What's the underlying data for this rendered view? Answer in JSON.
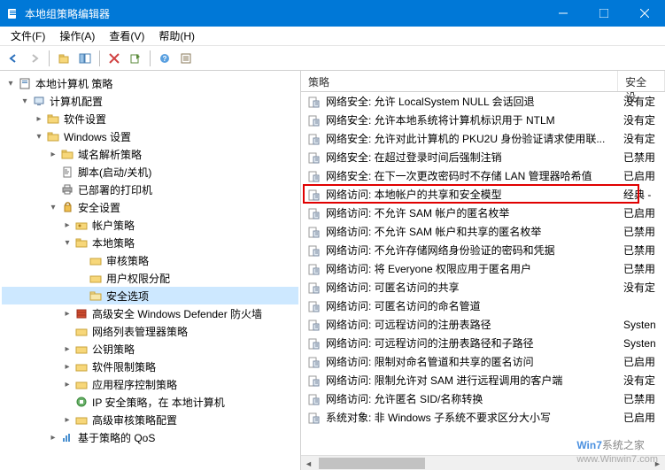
{
  "window": {
    "title": "本地组策略编辑器"
  },
  "menu": {
    "file": "文件(F)",
    "action": "操作(A)",
    "view": "查看(V)",
    "help": "帮助(H)"
  },
  "tree": {
    "root": "本地计算机 策略",
    "computer_config": "计算机配置",
    "software_settings": "软件设置",
    "windows_settings": "Windows 设置",
    "dns_policy": "域名解析策略",
    "scripts": "脚本(启动/关机)",
    "deployed_printers": "已部署的打印机",
    "security_settings": "安全设置",
    "account_policy": "帐户策略",
    "local_policy": "本地策略",
    "audit_policy": "审核策略",
    "user_rights": "用户权限分配",
    "security_options": "安全选项",
    "defender": "高级安全 Windows Defender 防火墙",
    "nlm": "网络列表管理器策略",
    "pki": "公钥策略",
    "srp": "软件限制策略",
    "app_control": "应用程序控制策略",
    "ipsec": "IP 安全策略，在 本地计算机",
    "advanced_audit": "高级审核策略配置",
    "qos": "基于策略的 QoS"
  },
  "list": {
    "header_policy": "策略",
    "header_status": "安全设",
    "items": [
      {
        "t": "网络安全: 允许 LocalSystem NULL 会话回退",
        "s": "没有定"
      },
      {
        "t": "网络安全: 允许本地系统将计算机标识用于 NTLM",
        "s": "没有定"
      },
      {
        "t": "网络安全: 允许对此计算机的 PKU2U 身份验证请求使用联...",
        "s": "没有定"
      },
      {
        "t": "网络安全: 在超过登录时间后强制注销",
        "s": "已禁用"
      },
      {
        "t": "网络安全: 在下一次更改密码时不存储 LAN 管理器哈希值",
        "s": "已启用"
      },
      {
        "t": "网络访问: 本地帐户的共享和安全模型",
        "s": "经典 -"
      },
      {
        "t": "网络访问: 不允许 SAM 帐户的匿名枚举",
        "s": "已启用"
      },
      {
        "t": "网络访问: 不允许 SAM 帐户和共享的匿名枚举",
        "s": "已禁用"
      },
      {
        "t": "网络访问: 不允许存储网络身份验证的密码和凭据",
        "s": "已禁用"
      },
      {
        "t": "网络访问: 将 Everyone 权限应用于匿名用户",
        "s": "已禁用"
      },
      {
        "t": "网络访问: 可匿名访问的共享",
        "s": "没有定"
      },
      {
        "t": "网络访问: 可匿名访问的命名管道",
        "s": ""
      },
      {
        "t": "网络访问: 可远程访问的注册表路径",
        "s": "Systen"
      },
      {
        "t": "网络访问: 可远程访问的注册表路径和子路径",
        "s": "Systen"
      },
      {
        "t": "网络访问: 限制对命名管道和共享的匿名访问",
        "s": "已启用"
      },
      {
        "t": "网络访问: 限制允许对 SAM 进行远程调用的客户端",
        "s": "没有定"
      },
      {
        "t": "网络访问: 允许匿名 SID/名称转换",
        "s": "已禁用"
      },
      {
        "t": "系统对象: 非 Windows 子系统不要求区分大小写",
        "s": "已启用"
      }
    ]
  },
  "watermark": {
    "en": "Win7",
    "cn": "系统之家",
    "url": "www.Winwin7.com"
  }
}
